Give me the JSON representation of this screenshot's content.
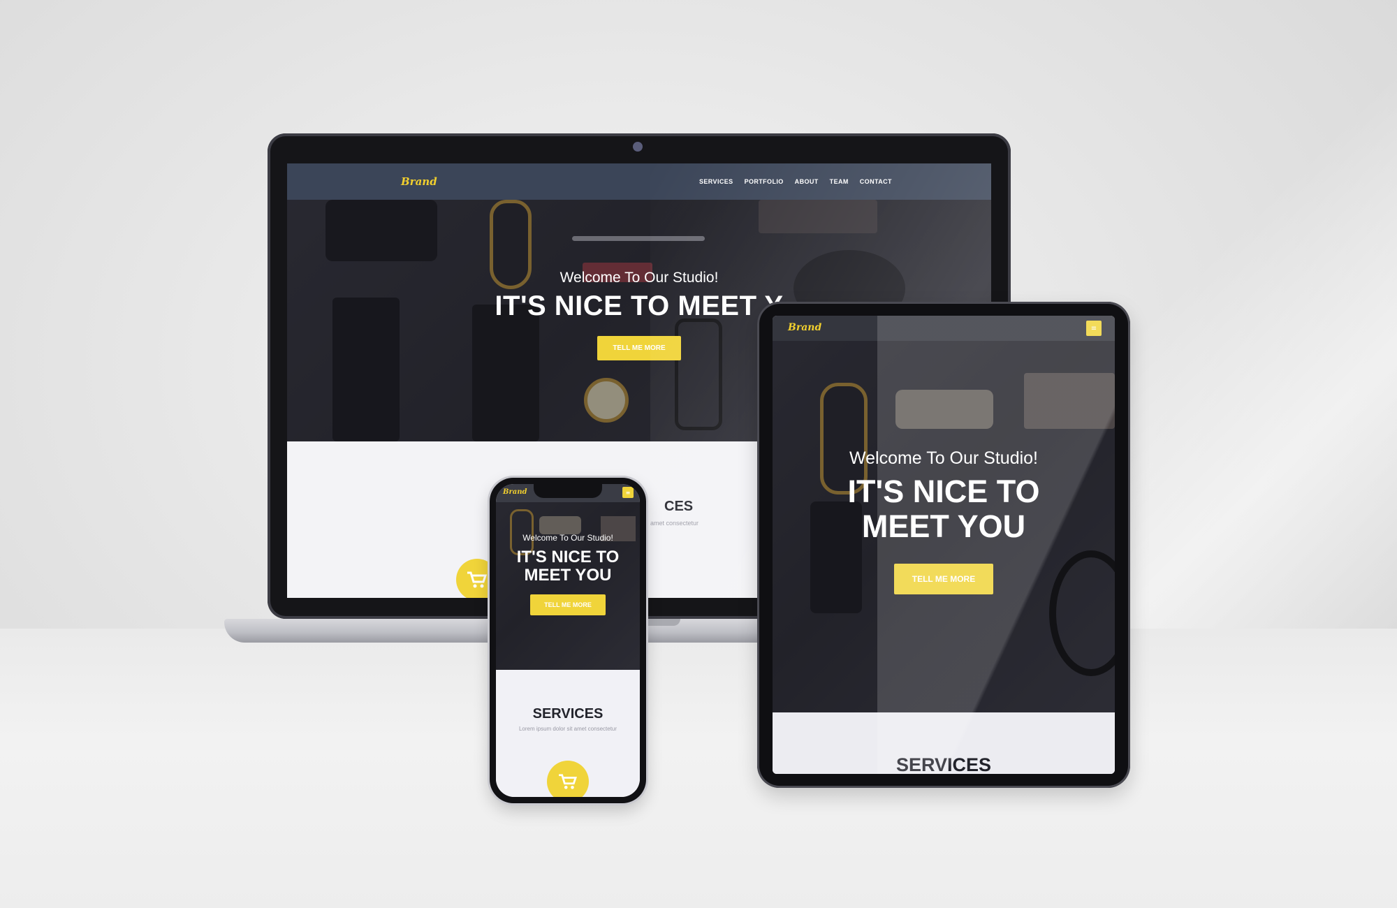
{
  "brand": "Brand",
  "nav": {
    "items": [
      "SERVICES",
      "PORTFOLIO",
      "ABOUT",
      "TEAM",
      "CONTACT"
    ]
  },
  "hero": {
    "welcome": "Welcome To Our Studio!",
    "headline": "IT'S NICE TO MEET YOU",
    "headline_laptop_visible": "IT'S NICE TO MEET Y",
    "headline_line1": "IT'S NICE TO",
    "headline_line2": "MEET YOU",
    "cta": "TELL ME MORE"
  },
  "services": {
    "title": "SERVICES",
    "title_laptop_visible": "CES",
    "subtitle": "Lorem ipsum dolor sit amet consectetur",
    "subtitle_laptop_visible": "amet consectetur"
  },
  "menu_icon": "hamburger-icon",
  "service_icon": "cart-icon",
  "colors": {
    "accent": "#f0d43a",
    "nav_bg": "#3b4558",
    "hero_dark": "#2a2a31",
    "section_bg": "#f3f3f6",
    "title_text": "#22232b"
  }
}
